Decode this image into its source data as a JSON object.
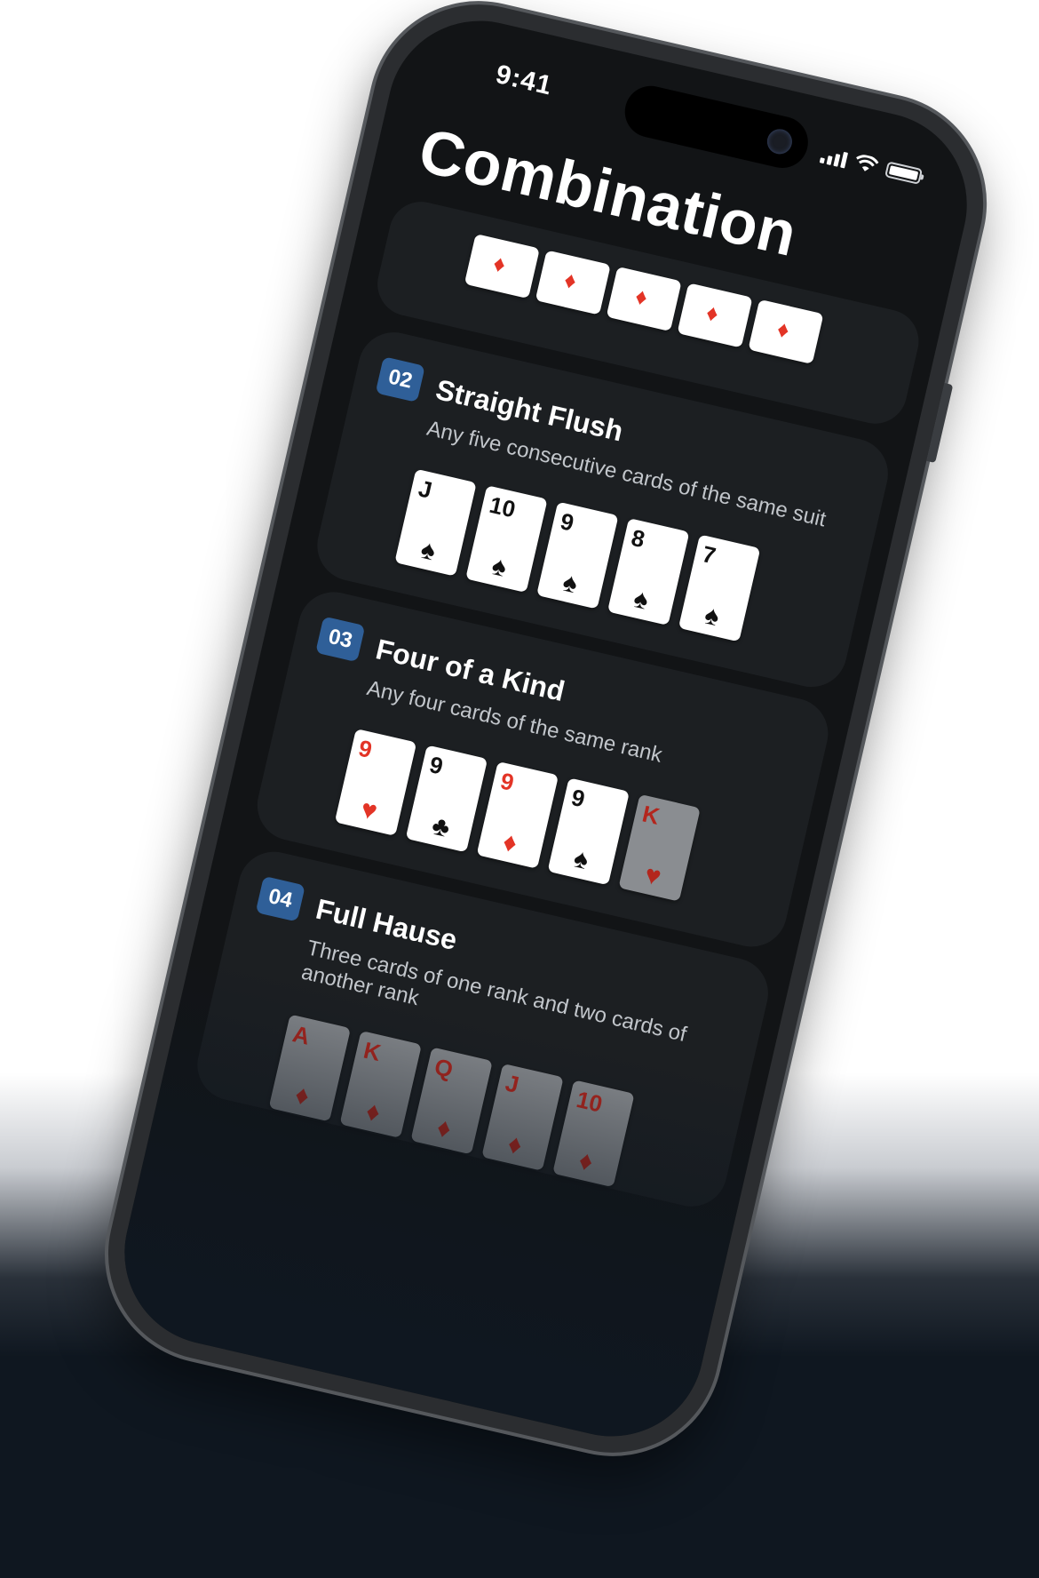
{
  "status_bar": {
    "time": "9:41"
  },
  "screen_title": "Combination",
  "royal_flush_preview": {
    "suit_symbol": "♦",
    "count": 5
  },
  "combinations": [
    {
      "number": "02",
      "name": "Straight Flush",
      "description": "Any five consecutive cards of the same suit",
      "cards": [
        {
          "rank": "J",
          "suit": "♠",
          "color": "black"
        },
        {
          "rank": "10",
          "suit": "♠",
          "color": "black"
        },
        {
          "rank": "9",
          "suit": "♠",
          "color": "black"
        },
        {
          "rank": "8",
          "suit": "♠",
          "color": "black"
        },
        {
          "rank": "7",
          "suit": "♠",
          "color": "black"
        }
      ]
    },
    {
      "number": "03",
      "name": "Four of a Kind",
      "description": "Any four cards of the same rank",
      "cards": [
        {
          "rank": "9",
          "suit": "♥",
          "color": "red"
        },
        {
          "rank": "9",
          "suit": "♣",
          "color": "black"
        },
        {
          "rank": "9",
          "suit": "♦",
          "color": "red"
        },
        {
          "rank": "9",
          "suit": "♠",
          "color": "black"
        },
        {
          "rank": "K",
          "suit": "♥",
          "color": "red",
          "dimmed": true
        }
      ]
    },
    {
      "number": "04",
      "name": "Full Hause",
      "description": "Three cards of one rank and two cards of another rank",
      "cards": [
        {
          "rank": "A",
          "suit": "♦",
          "color": "red",
          "dimmed": true
        },
        {
          "rank": "K",
          "suit": "♦",
          "color": "red",
          "dimmed": true
        },
        {
          "rank": "Q",
          "suit": "♦",
          "color": "red",
          "dimmed": true
        },
        {
          "rank": "J",
          "suit": "♦",
          "color": "red",
          "dimmed": true
        },
        {
          "rank": "10",
          "suit": "♦",
          "color": "red",
          "dimmed": true
        }
      ]
    }
  ],
  "colors": {
    "badge": "#2f5f98",
    "card_red": "#e33426",
    "screen_bg": "#121416",
    "panel_bg": "#1c1f22"
  }
}
